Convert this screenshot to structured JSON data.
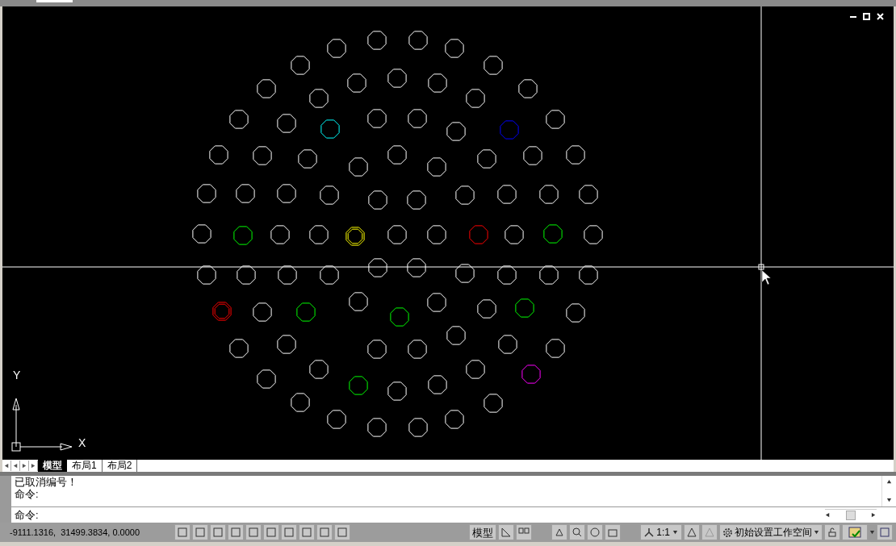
{
  "viewport": {
    "axis_labels": {
      "x": "X",
      "y": "Y"
    }
  },
  "layout_tabs": [
    {
      "label": "模型",
      "selected": true
    },
    {
      "label": "布局1",
      "selected": false
    },
    {
      "label": "布局2",
      "selected": false
    }
  ],
  "command_history": [
    "已取消编号！",
    "命令:"
  ],
  "command_prompt": "命令:",
  "status_bar": {
    "coordinates": "-9111.1316,  31499.3834, 0.0000",
    "model_button": "模型",
    "annotation_scale": "1:1",
    "workspace": "初始设置工作空间"
  }
}
